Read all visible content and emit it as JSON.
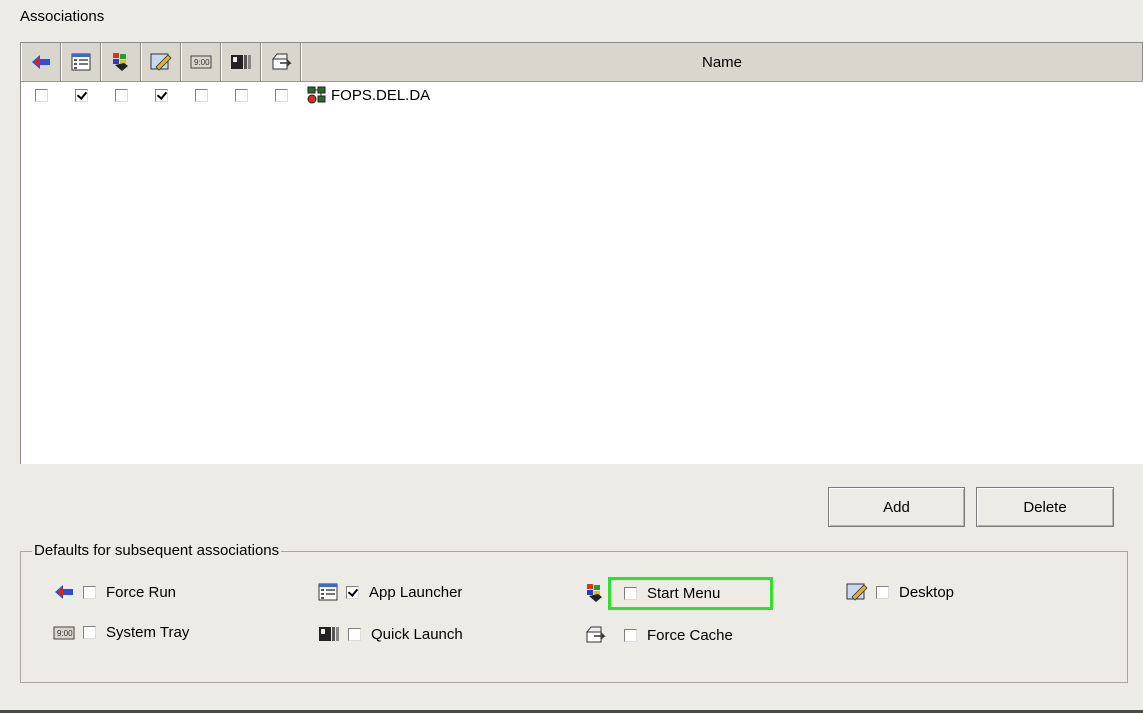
{
  "associations_label": "Associations",
  "columns": [
    {
      "icon": "force-run-icon"
    },
    {
      "icon": "app-launcher-icon"
    },
    {
      "icon": "start-menu-icon"
    },
    {
      "icon": "desktop-icon"
    },
    {
      "icon": "system-tray-icon"
    },
    {
      "icon": "quick-launch-icon"
    },
    {
      "icon": "force-cache-icon"
    }
  ],
  "name_header": "Name",
  "rows": [
    {
      "name": "FOPS.DEL.DA",
      "checks": [
        false,
        true,
        false,
        true,
        false,
        false,
        false
      ]
    }
  ],
  "buttons": {
    "add": "Add",
    "delete": "Delete"
  },
  "defaults": {
    "title": "Defaults for subsequent associations",
    "options": [
      {
        "label": "Force Run",
        "checked": false,
        "icon": "force-run-icon"
      },
      {
        "label": "App Launcher",
        "checked": true,
        "icon": "app-launcher-icon"
      },
      {
        "label": "Start Menu",
        "checked": false,
        "icon": "start-menu-icon"
      },
      {
        "label": "Desktop",
        "checked": false,
        "icon": "desktop-icon"
      },
      {
        "label": "System Tray",
        "checked": false,
        "icon": "system-tray-icon"
      },
      {
        "label": "Quick Launch",
        "checked": false,
        "icon": "quick-launch-icon"
      },
      {
        "label": "Force Cache",
        "checked": false,
        "icon": "force-cache-icon"
      }
    ]
  },
  "colors": {
    "highlight": "#2fe02f",
    "background": "#ecebe5"
  }
}
